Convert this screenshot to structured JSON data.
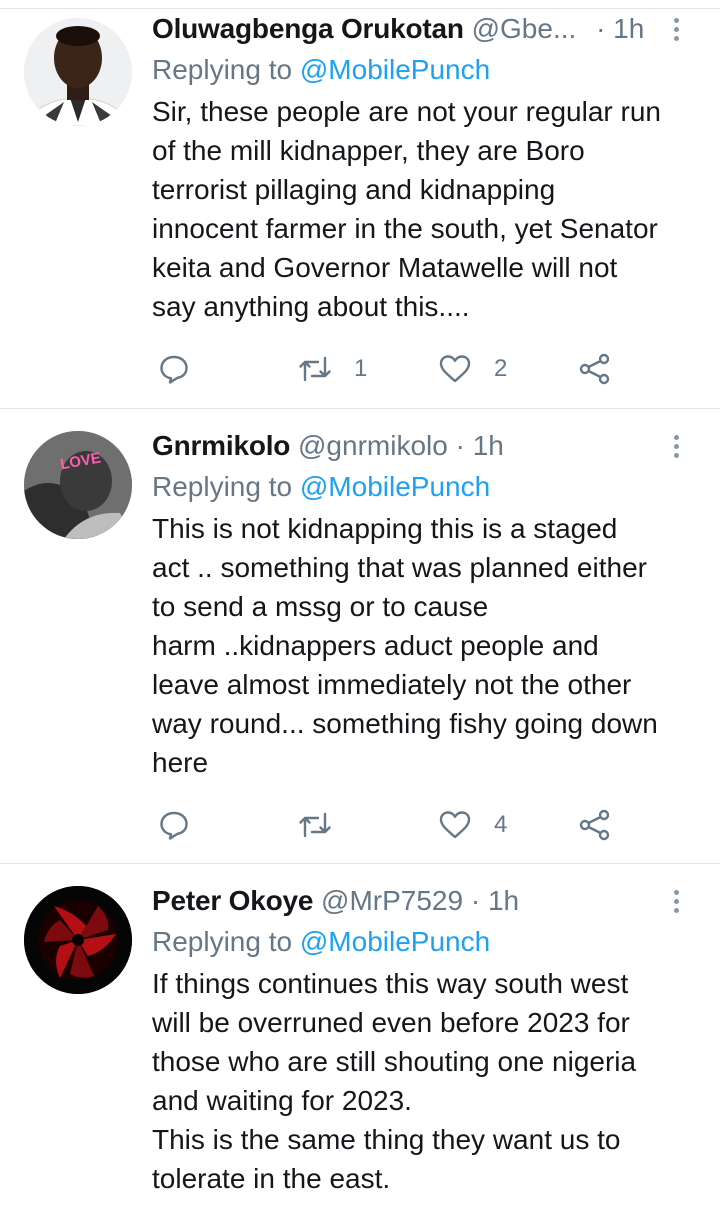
{
  "tweets": [
    {
      "name": "Oluwagbenga Orukotan",
      "handle": "@Gbe...",
      "separator": "·",
      "time": "1h",
      "replying_label": "Replying to",
      "replying_to": "@MobilePunch",
      "text": "Sir, these people are not your regular run\nof the mill kidnapper,  they are Boro\nterrorist  pillaging and kidnapping\ninnocent farmer in the south, yet Senator\nkeita and Governor Matawelle will not\nsay anything about this....",
      "reply_count": "",
      "retweet_count": "1",
      "like_count": "2"
    },
    {
      "name": "Gnrmikolo",
      "handle": "@gnrmikolo",
      "separator": "·",
      "time": "1h",
      "replying_label": "Replying to",
      "replying_to": "@MobilePunch",
      "text": "This is not kidnapping this is a staged\nact .. something that was planned either\nto send a mssg or to cause\nharm ..kidnappers aduct people and\nleave almost immediately not the other\nway round... something fishy going down\nhere",
      "avatar_text": "LOVE",
      "reply_count": "",
      "retweet_count": "",
      "like_count": "4"
    },
    {
      "name": "Peter Okoye",
      "handle": "@MrP7529",
      "separator": "·",
      "time": "1h",
      "replying_label": "Replying to",
      "replying_to": "@MobilePunch",
      "text": "If things continues this way south west\nwill be overruned even before 2023 for\nthose who are still shouting one nigeria\nand waiting for 2023.\nThis is the same thing they want us to\ntolerate in the east."
    }
  ],
  "colors": {
    "link": "#1da1f2",
    "secondary_text": "#657786",
    "icon": "#657786",
    "divider": "#dde3e8"
  }
}
